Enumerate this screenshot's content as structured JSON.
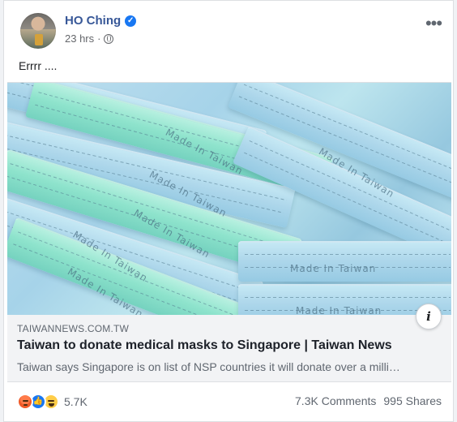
{
  "post": {
    "author": "HO Ching",
    "time": "23 hrs",
    "text": "Errrr ...."
  },
  "icons": {
    "verified": "verified-check-icon",
    "privacy": "globe-icon",
    "more": "more-options-icon",
    "info": "info-icon"
  },
  "link_preview": {
    "domain": "TAIWANNEWS.COM.TW",
    "headline": "Taiwan to donate medical masks to Singapore | Taiwan News",
    "summary": "Taiwan says Singapore is on list of NSP countries it will donate over a milli…"
  },
  "image": {
    "mask_text": "Made In Taiwan"
  },
  "footer": {
    "reaction_count": "5.7K",
    "comments": "7.3K Comments",
    "shares": "995 Shares"
  },
  "colors": {
    "facebook_blue": "#1877f2",
    "author_link": "#385898",
    "mask_blue": "#a6d3e9",
    "mask_green": "#8ee3cc"
  }
}
